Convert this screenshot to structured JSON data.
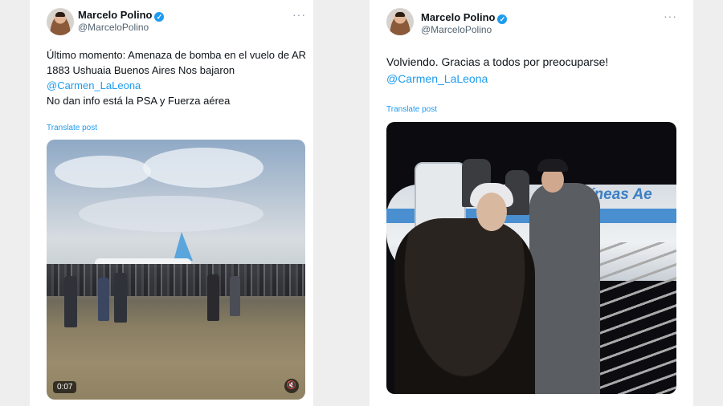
{
  "tweets": [
    {
      "author": {
        "name": "Marcelo Polino",
        "handle": "@MarceloPolino",
        "verified": true
      },
      "text_lines": [
        "Último momento: Amenaza de bomba en el vuelo de AR",
        "1883  Ushuaia Buenos Aires Nos bajaron"
      ],
      "mention": "@Carmen_LaLeona",
      "text_after": "No dan info está la PSA y Fuerza aérea",
      "translate_label": "Translate post",
      "more_label": "···",
      "media": {
        "type": "video",
        "duration": "0:07"
      }
    },
    {
      "author": {
        "name": "Marcelo Polino",
        "handle": "@MarceloPolino",
        "verified": true
      },
      "text_lines": [
        "Volviendo. Gracias a todos por preocuparse!"
      ],
      "mention": "@Carmen_LaLeona",
      "translate_label": "Translate post",
      "more_label": "···",
      "media": {
        "type": "image",
        "brand_text": "líneas Ae"
      }
    }
  ],
  "colors": {
    "link": "#1d9bf0",
    "secondary": "#536471",
    "verified": "#1d9bf0"
  },
  "icons": [
    "verified-badge-icon",
    "more-options-icon",
    "volume-muted-icon"
  ]
}
